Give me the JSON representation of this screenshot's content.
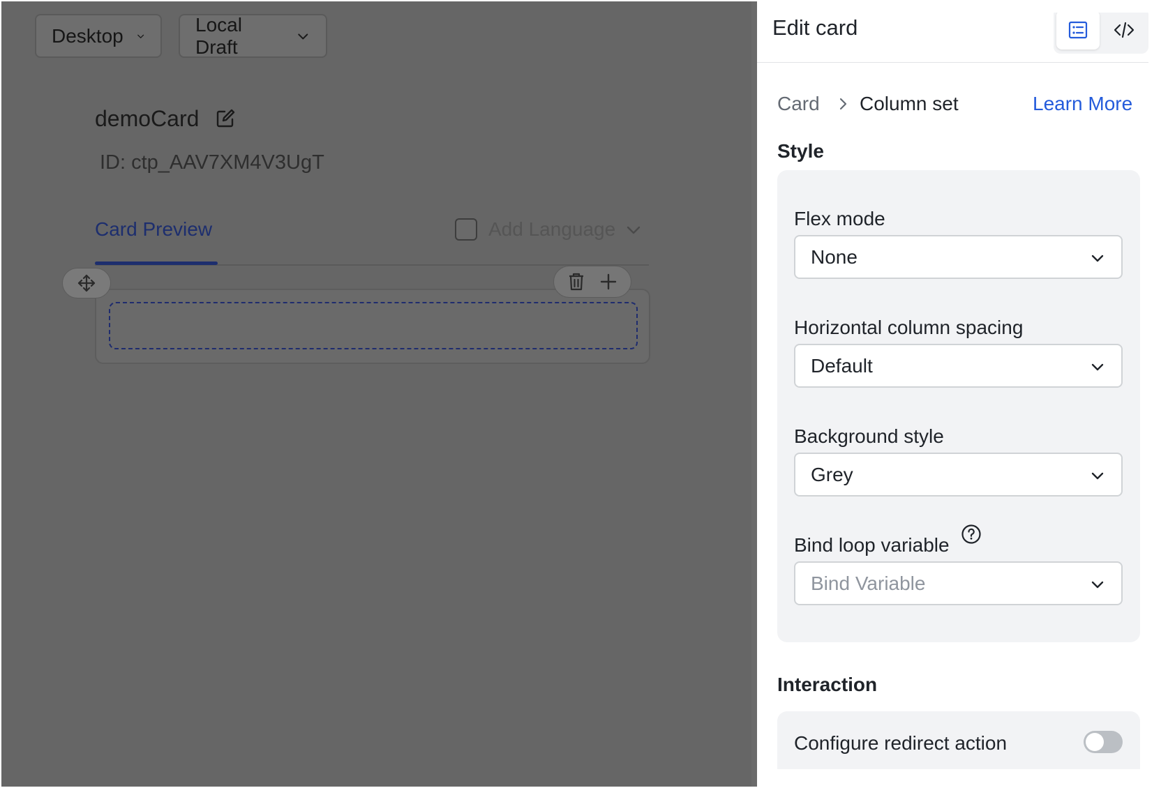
{
  "canvas": {
    "device_select": "Desktop",
    "version_select": "Local Draft",
    "card_name": "demoCard",
    "card_id": "ID: ctp_AAV7XM4V3UgT",
    "tab_preview": "Card Preview",
    "add_language": "Add Language"
  },
  "panel": {
    "title": "Edit card",
    "breadcrumb": {
      "root": "Card",
      "current": "Column set",
      "learn_more": "Learn More"
    },
    "style_section": {
      "title": "Style",
      "fields": [
        {
          "label": "Flex mode",
          "value": "None"
        },
        {
          "label": "Horizontal column spacing",
          "value": "Default"
        },
        {
          "label": "Background style",
          "value": "Grey"
        },
        {
          "label": "Bind loop variable",
          "placeholder": "Bind Variable"
        }
      ]
    },
    "interaction_section": {
      "title": "Interaction",
      "redirect_label": "Configure redirect action",
      "redirect_enabled": false
    }
  },
  "colors": {
    "accent": "#245bdb",
    "overlay": "#666666",
    "panel_bg": "#ffffff",
    "field_group_bg": "#f2f3f5"
  },
  "icons": [
    "chevron-down-icon",
    "edit-icon",
    "move-icon",
    "trash-icon",
    "plus-icon",
    "list-view-icon",
    "code-view-icon",
    "chevron-right-icon",
    "help-icon"
  ]
}
